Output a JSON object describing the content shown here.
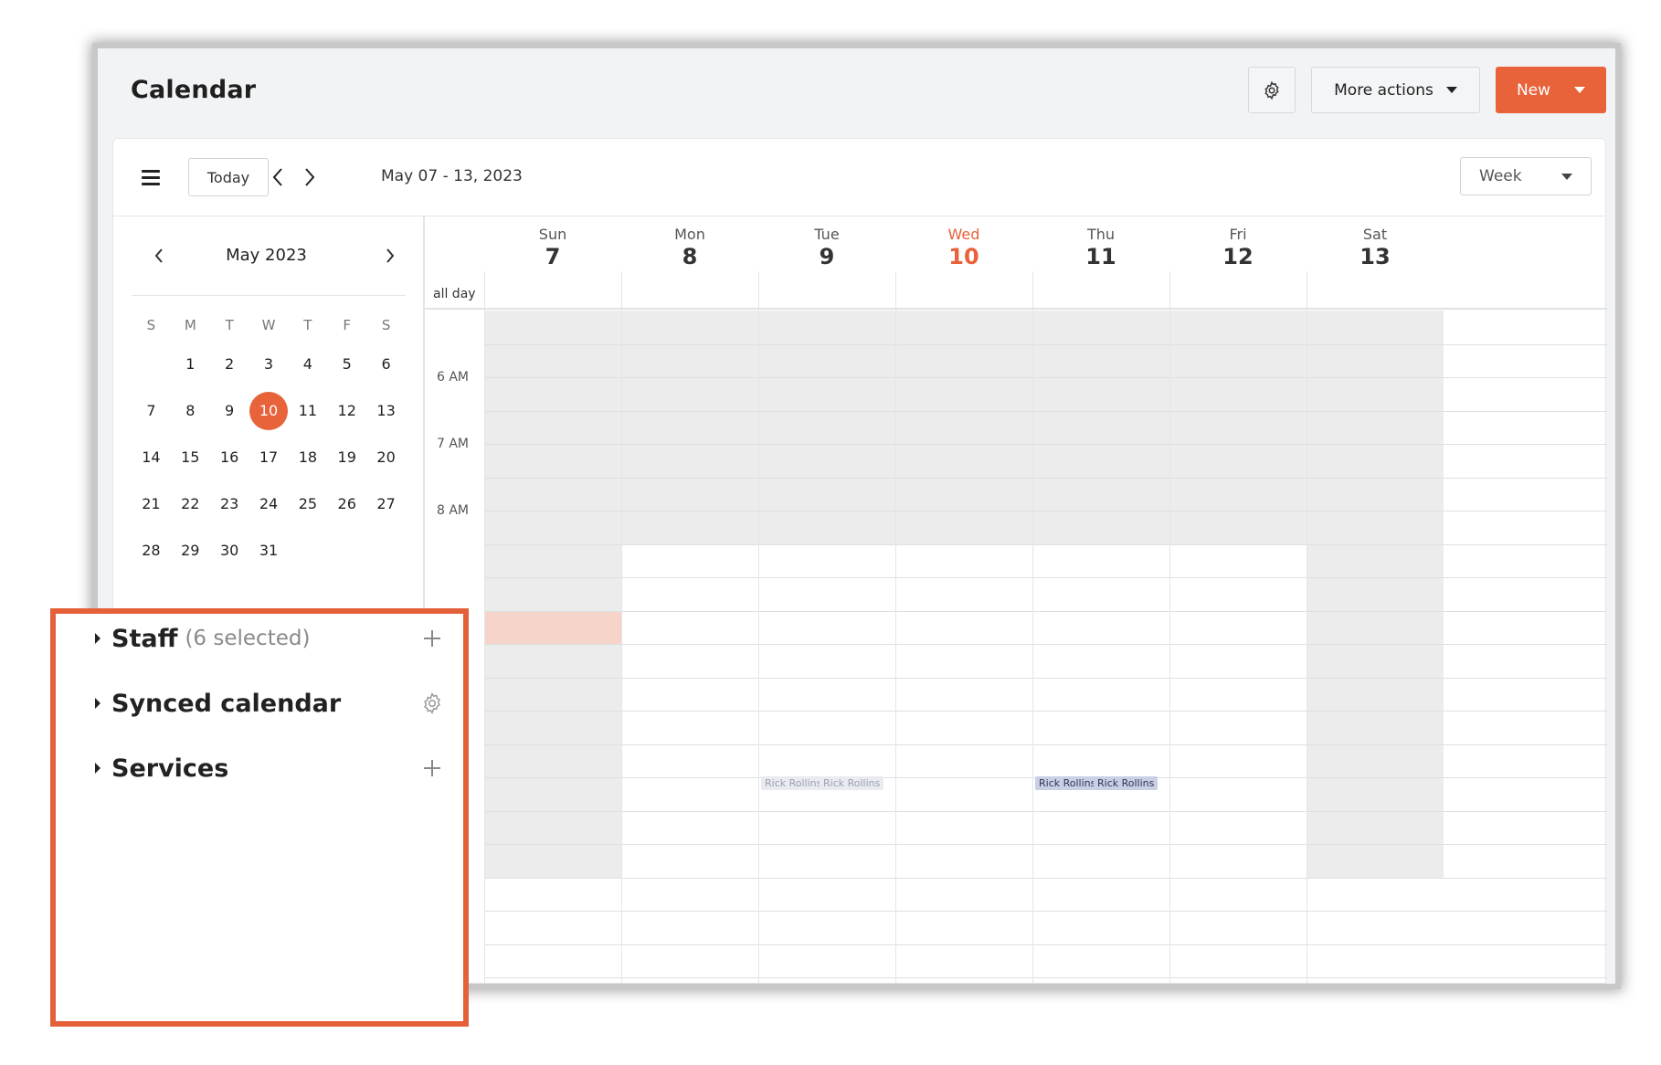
{
  "header": {
    "title": "Calendar",
    "settings_icon": "gear-icon",
    "more_actions_label": "More actions",
    "new_label": "New",
    "accent_color": "#e8623a"
  },
  "toolbar": {
    "menu_icon": "hamburger-icon",
    "today_label": "Today",
    "date_range": "May 07 - 13, 2023",
    "view_select": "Week"
  },
  "mini_calendar": {
    "title": "May 2023",
    "weekday_headers": [
      "S",
      "M",
      "T",
      "W",
      "T",
      "F",
      "S"
    ],
    "weeks": [
      [
        "",
        "1",
        "2",
        "3",
        "4",
        "5",
        "6"
      ],
      [
        "7",
        "8",
        "9",
        "10",
        "11",
        "12",
        "13"
      ],
      [
        "14",
        "15",
        "16",
        "17",
        "18",
        "19",
        "20"
      ],
      [
        "21",
        "22",
        "23",
        "24",
        "25",
        "26",
        "27"
      ],
      [
        "28",
        "29",
        "30",
        "31",
        "",
        "",
        ""
      ]
    ],
    "selected_day": "10"
  },
  "week": {
    "days": [
      {
        "name": "Sun",
        "date": "7"
      },
      {
        "name": "Mon",
        "date": "8"
      },
      {
        "name": "Tue",
        "date": "9"
      },
      {
        "name": "Wed",
        "date": "10"
      },
      {
        "name": "Thu",
        "date": "11"
      },
      {
        "name": "Fri",
        "date": "12"
      },
      {
        "name": "Sat",
        "date": "13"
      }
    ],
    "today_index": 3,
    "all_day_label": "all day",
    "time_labels": [
      "6 AM",
      "7 AM",
      "8 AM"
    ],
    "events": [
      {
        "day": 2,
        "label": "Rick Rollins",
        "style": "light"
      },
      {
        "day": 2,
        "label": "Rick Rollins",
        "style": "light"
      },
      {
        "day": 4,
        "label": "Rick Rollins",
        "style": "dark"
      },
      {
        "day": 4,
        "label": "Rick Rollins",
        "style": "dark"
      }
    ]
  },
  "sidebar_sections": [
    {
      "title": "Staff",
      "subtitle": "(6 selected)",
      "action_icon": "plus-icon"
    },
    {
      "title": "Synced calendar",
      "subtitle": "",
      "action_icon": "gear-icon"
    },
    {
      "title": "Services",
      "subtitle": "",
      "action_icon": "plus-icon"
    }
  ]
}
